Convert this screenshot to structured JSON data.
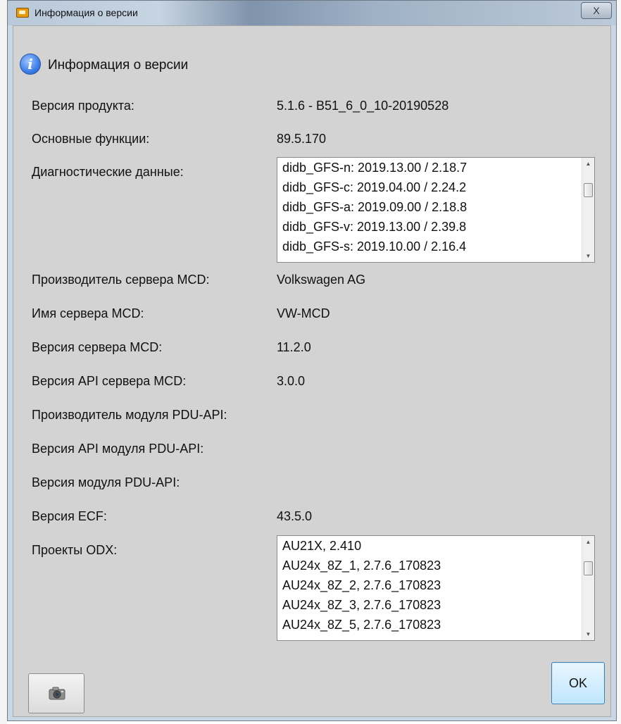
{
  "window": {
    "title": "Информация о версии",
    "close_glyph": "X"
  },
  "header": {
    "icon": "info-icon",
    "title": "Информация о версии"
  },
  "rows": [
    {
      "label": "Версия продукта:",
      "value": "5.1.6  -  B51_6_0_10-20190528"
    },
    {
      "label": "Основные функции:",
      "value": "89.5.170"
    },
    {
      "label": "Диагностические данные:"
    },
    {
      "label": "Производитель сервера MCD:",
      "value": "Volkswagen AG"
    },
    {
      "label": "Имя сервера MCD:",
      "value": "VW-MCD"
    },
    {
      "label": "Версия сервера MCD:",
      "value": "11.2.0"
    },
    {
      "label": "Версия API сервера MCD:",
      "value": "3.0.0"
    },
    {
      "label": "Производитель модуля PDU-API:",
      "value": ""
    },
    {
      "label": "Версия API модуля PDU-API:",
      "value": ""
    },
    {
      "label": "Версия модуля PDU-API:",
      "value": ""
    },
    {
      "label": "Версия ECF:",
      "value": "43.5.0"
    },
    {
      "label": "Проекты ODX:"
    }
  ],
  "diagnostic_data_list": [
    "didb_GFS-n: 2019.13.00 / 2.18.7",
    "didb_GFS-c: 2019.04.00 / 2.24.2",
    "didb_GFS-a: 2019.09.00 / 2.18.8",
    "didb_GFS-v: 2019.13.00 / 2.39.8",
    "didb_GFS-s: 2019.10.00 / 2.16.4"
  ],
  "odx_projects_list": [
    "AU21X, 2.410",
    "AU24x_8Z_1, 2.7.6_170823",
    "AU24x_8Z_2, 2.7.6_170823",
    "AU24x_8Z_3, 2.7.6_170823",
    "AU24x_8Z_5, 2.7.6_170823"
  ],
  "buttons": {
    "screenshot_icon": "camera-icon",
    "ok_label": "OK"
  },
  "colors": {
    "dialog_background": "#d3d3d3",
    "ok_button_border": "#3c7fb1",
    "title_icon": "#e79a10"
  }
}
